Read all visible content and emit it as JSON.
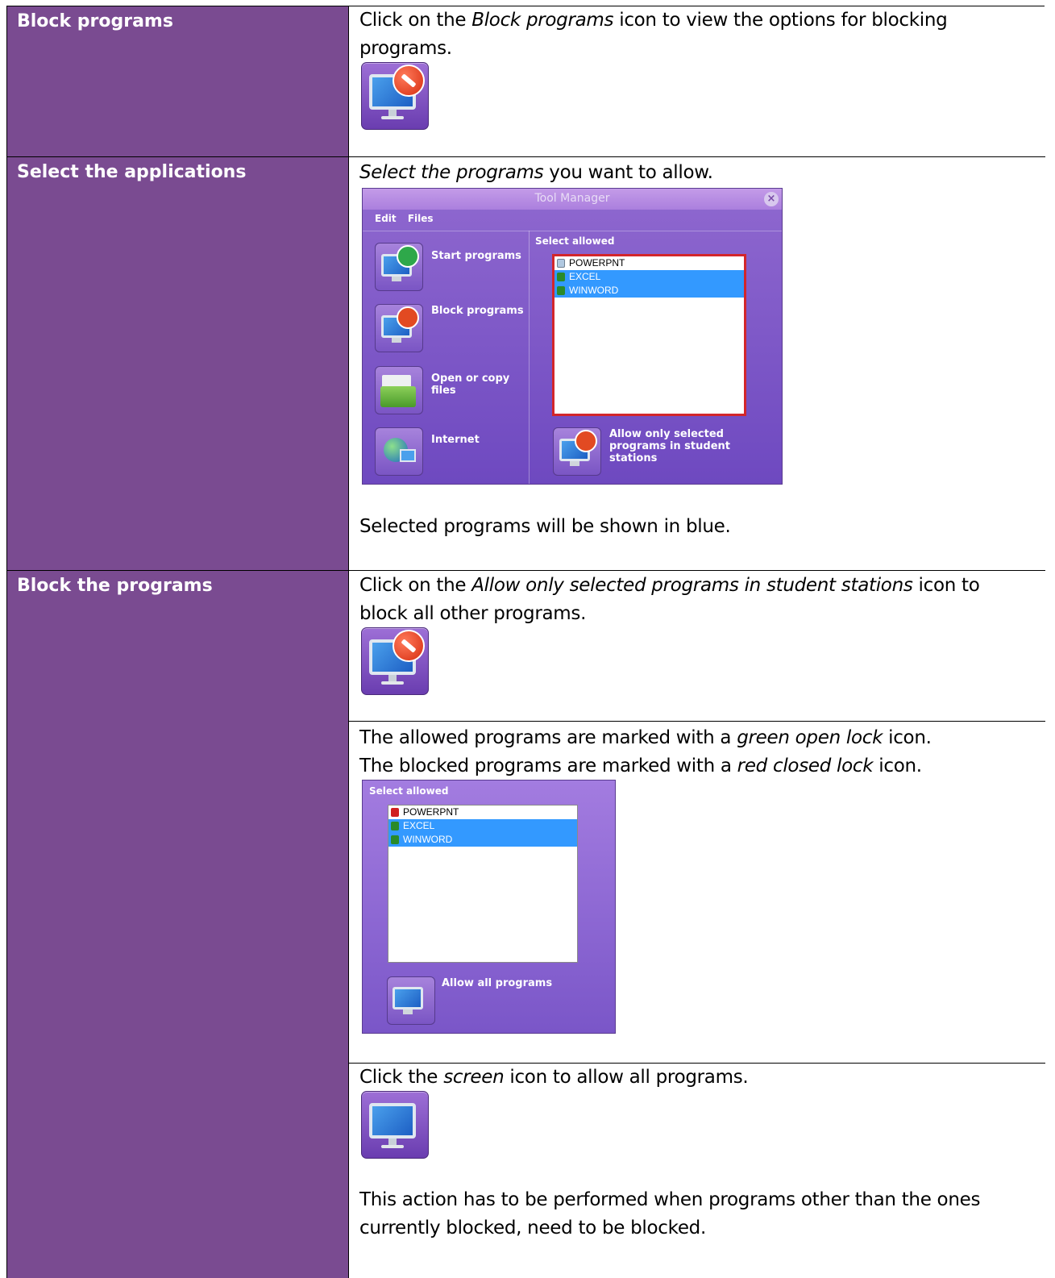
{
  "rows": [
    {
      "label": "Block programs",
      "text_pre": "Click on the ",
      "text_em": "Block programs",
      "text_post": " icon to view the options for blocking programs."
    },
    {
      "label": "Select the applications",
      "text_em": "Select the programs",
      "text_post": " you want to allow.",
      "note": "Selected programs will be shown in blue."
    },
    {
      "label": "Block the programs",
      "text_pre": "Click on the ",
      "text_em": "Allow only selected programs in student stations",
      "text_post": " icon to block all other programs.",
      "lock_line1_pre": "The allowed programs are marked with a ",
      "lock_line1_em": "green open lock",
      "lock_line1_post": " icon.",
      "lock_line2_pre": "The blocked programs are marked with a ",
      "lock_line2_em": "red closed lock",
      "lock_line2_post": " icon.",
      "screen_pre": "Click the ",
      "screen_em": "screen",
      "screen_post": " icon to allow all programs.",
      "final_note": "This action has to be performed when programs other than the ones currently blocked, need to be blocked."
    }
  ],
  "tool_manager": {
    "title": "Tool Manager",
    "menu": [
      "Edit",
      "Files"
    ],
    "buttons": [
      "Start programs",
      "Block programs",
      "Open or copy files",
      "Internet"
    ],
    "select_allowed": "Select allowed",
    "programs": [
      {
        "name": "POWERPNT",
        "selected": false,
        "icon": "program-icon"
      },
      {
        "name": "EXCEL",
        "selected": true,
        "icon": "green-open-lock-icon"
      },
      {
        "name": "WINWORD",
        "selected": true,
        "icon": "green-open-lock-icon"
      }
    ],
    "allow_selected_label": "Allow only selected programs in student stations"
  },
  "select_panel": {
    "title": "Select allowed",
    "programs": [
      {
        "name": "POWERPNT",
        "selected": false,
        "icon": "red-closed-lock-icon"
      },
      {
        "name": "EXCEL",
        "selected": true,
        "icon": "green-open-lock-icon"
      },
      {
        "name": "WINWORD",
        "selected": true,
        "icon": "green-open-lock-icon"
      }
    ],
    "allow_all_label": "Allow all programs"
  },
  "colors": {
    "label_bg": "#7a4b91",
    "selected_row": "#3399ff",
    "list_highlight_border": "#d3262b"
  }
}
